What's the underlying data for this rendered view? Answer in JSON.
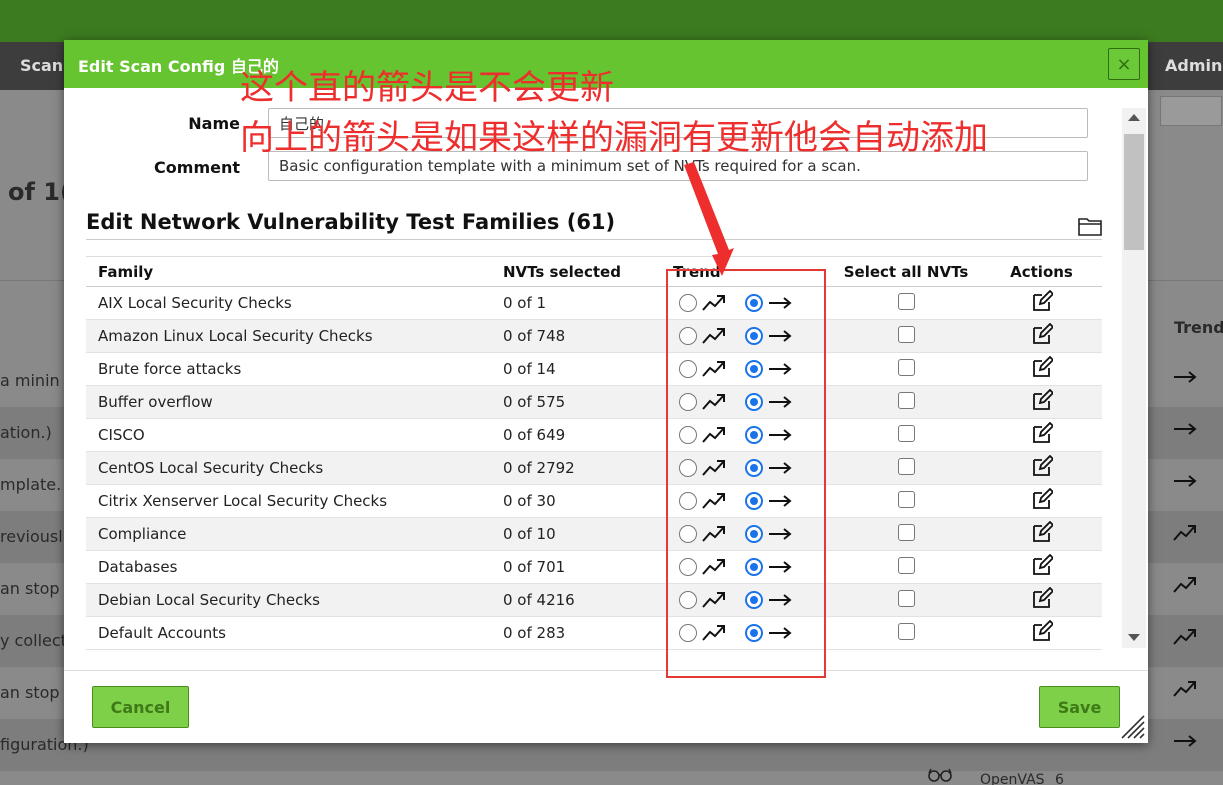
{
  "background": {
    "nav": {
      "left_item": "Scan",
      "right_item": "Admin"
    },
    "count_text": "of 1(",
    "trend_header": "Trend",
    "rows": [
      {
        "text": "a minin",
        "trend": "arrow-right-icon"
      },
      {
        "text": "ation.)",
        "trend": "arrow-right-icon"
      },
      {
        "text": "mplate.",
        "trend": "arrow-right-icon"
      },
      {
        "text": "reviousl",
        "trend": "trend-up-icon"
      },
      {
        "text": "an stop",
        "trend": "trend-up-icon"
      },
      {
        "text": "y collect",
        "trend": "trend-up-icon"
      },
      {
        "text": "an stop",
        "trend": "trend-up-icon"
      },
      {
        "text": "figuration.)",
        "trend": "arrow-right-icon"
      }
    ],
    "bottom": {
      "openvas": "OpenVAS",
      "number": "6"
    }
  },
  "dialog": {
    "title": "Edit Scan Config 自己的",
    "close_label": "×",
    "name_label": "Name",
    "name_value": "自己的",
    "comment_label": "Comment",
    "comment_value": "Basic configuration template with a minimum set of NVTs required for a scan.",
    "section_title": "Edit Network Vulnerability Test Families (61)",
    "columns": [
      "Family",
      "NVTs selected",
      "Trend",
      "Select all NVTs",
      "Actions"
    ],
    "families": [
      {
        "family": "AIX Local Security Checks",
        "nvts": "0 of 1"
      },
      {
        "family": "Amazon Linux Local Security Checks",
        "nvts": "0 of 748"
      },
      {
        "family": "Brute force attacks",
        "nvts": "0 of 14"
      },
      {
        "family": "Buffer overflow",
        "nvts": "0 of 575"
      },
      {
        "family": "CISCO",
        "nvts": "0 of 649"
      },
      {
        "family": "CentOS Local Security Checks",
        "nvts": "0 of 2792"
      },
      {
        "family": "Citrix Xenserver Local Security Checks",
        "nvts": "0 of 30"
      },
      {
        "family": "Compliance",
        "nvts": "0 of 10"
      },
      {
        "family": "Databases",
        "nvts": "0 of 701"
      },
      {
        "family": "Debian Local Security Checks",
        "nvts": "0 of 4216"
      },
      {
        "family": "Default Accounts",
        "nvts": "0 of 283"
      }
    ],
    "cancel_label": "Cancel",
    "save_label": "Save"
  },
  "annotation": {
    "line1": "这个直的箭头是不会更新",
    "line2": "向上的箭头是如果这样的漏洞有更新他会自动添加",
    "color": "#ee2d2d"
  },
  "colors": {
    "header_green": "#66c430",
    "button_green": "#7fd049",
    "radio_blue": "#1a73e8"
  }
}
